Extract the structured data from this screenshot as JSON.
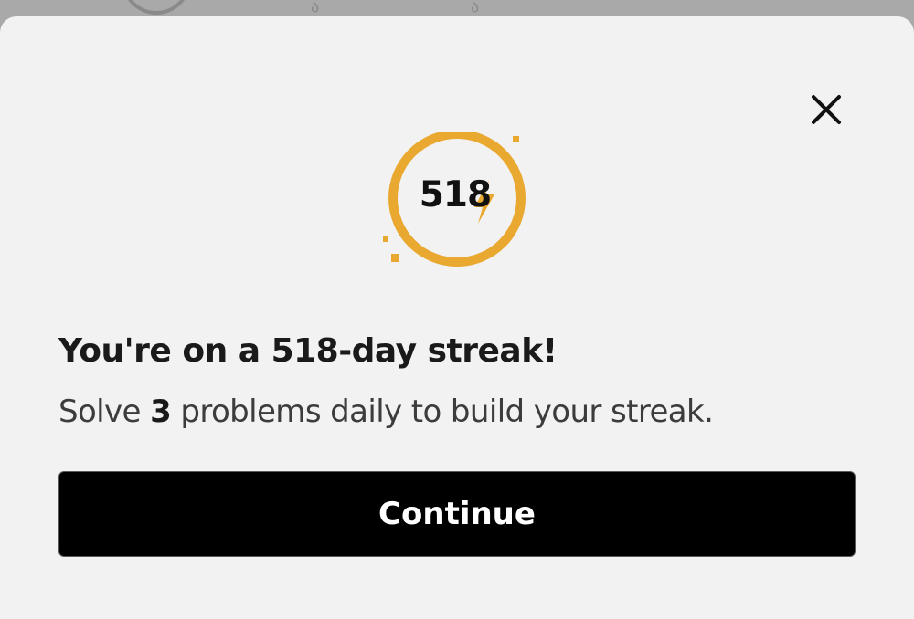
{
  "background": {
    "glyphs": [
      "ა",
      "ა"
    ]
  },
  "modal": {
    "close_icon": "close-icon",
    "badge": {
      "number": "518",
      "icon": "lightning-bolt-icon",
      "ring_color": "#e9a830"
    },
    "title": "You're on a 518-day streak!",
    "subtitle": {
      "prefix": "Solve ",
      "count": "3",
      "suffix": " problems daily to build your streak."
    },
    "continue_label": "Continue"
  }
}
